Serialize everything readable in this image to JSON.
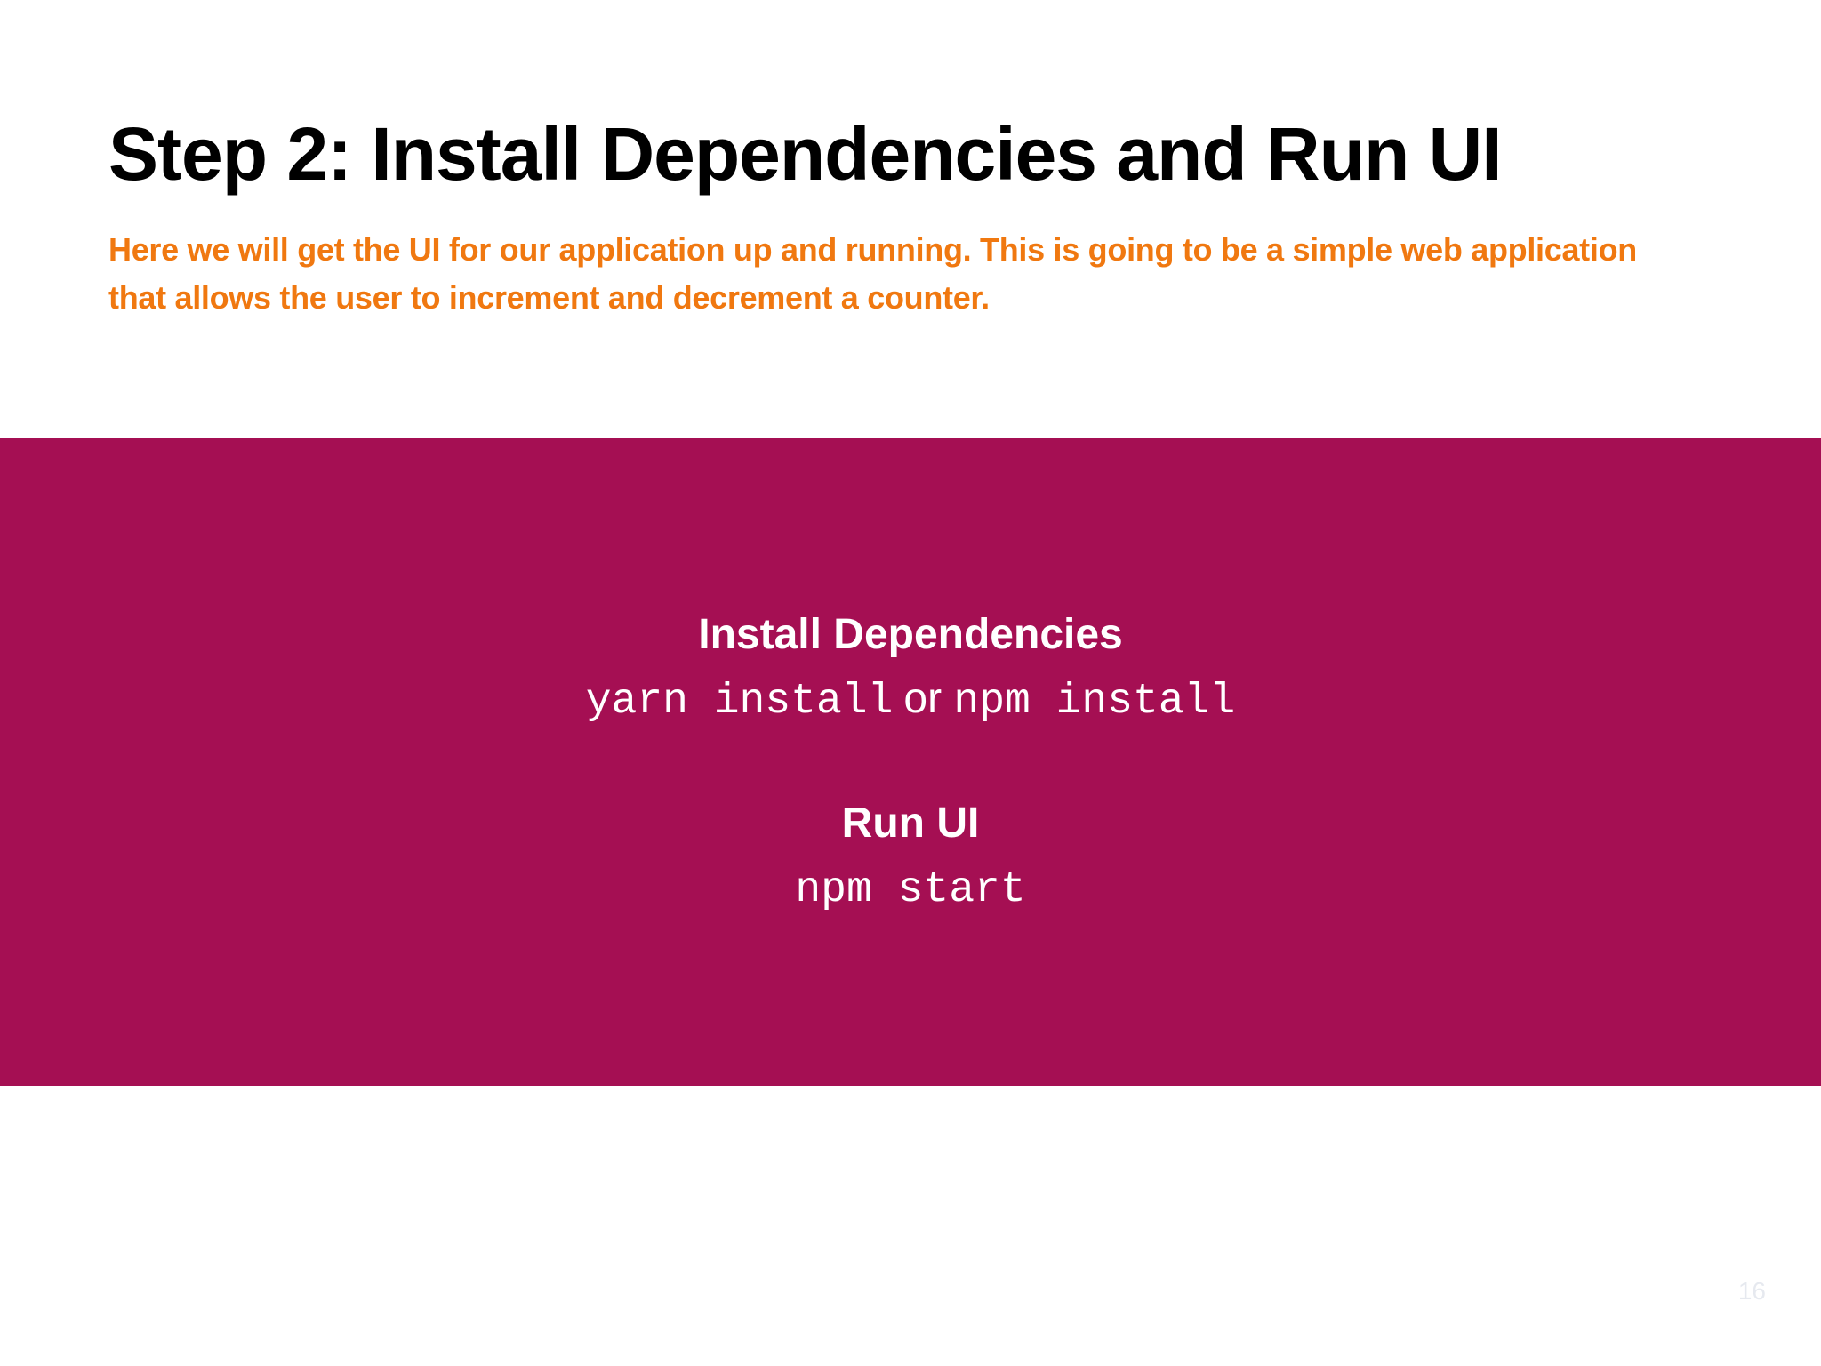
{
  "slide": {
    "title": "Step 2: Install Dependencies and Run UI",
    "subtitle": "Here we will get the UI for our application up and running. This is going to be a simple web application that allows the user to increment and decrement a counter.",
    "band_color": "#a50f53",
    "accent_color": "#f07810",
    "sections": [
      {
        "heading": "Install Dependencies",
        "command_a": "yarn install",
        "connector": "or",
        "command_b": "npm install"
      },
      {
        "heading": "Run UI",
        "command": "npm start"
      }
    ],
    "page_number": "16"
  }
}
